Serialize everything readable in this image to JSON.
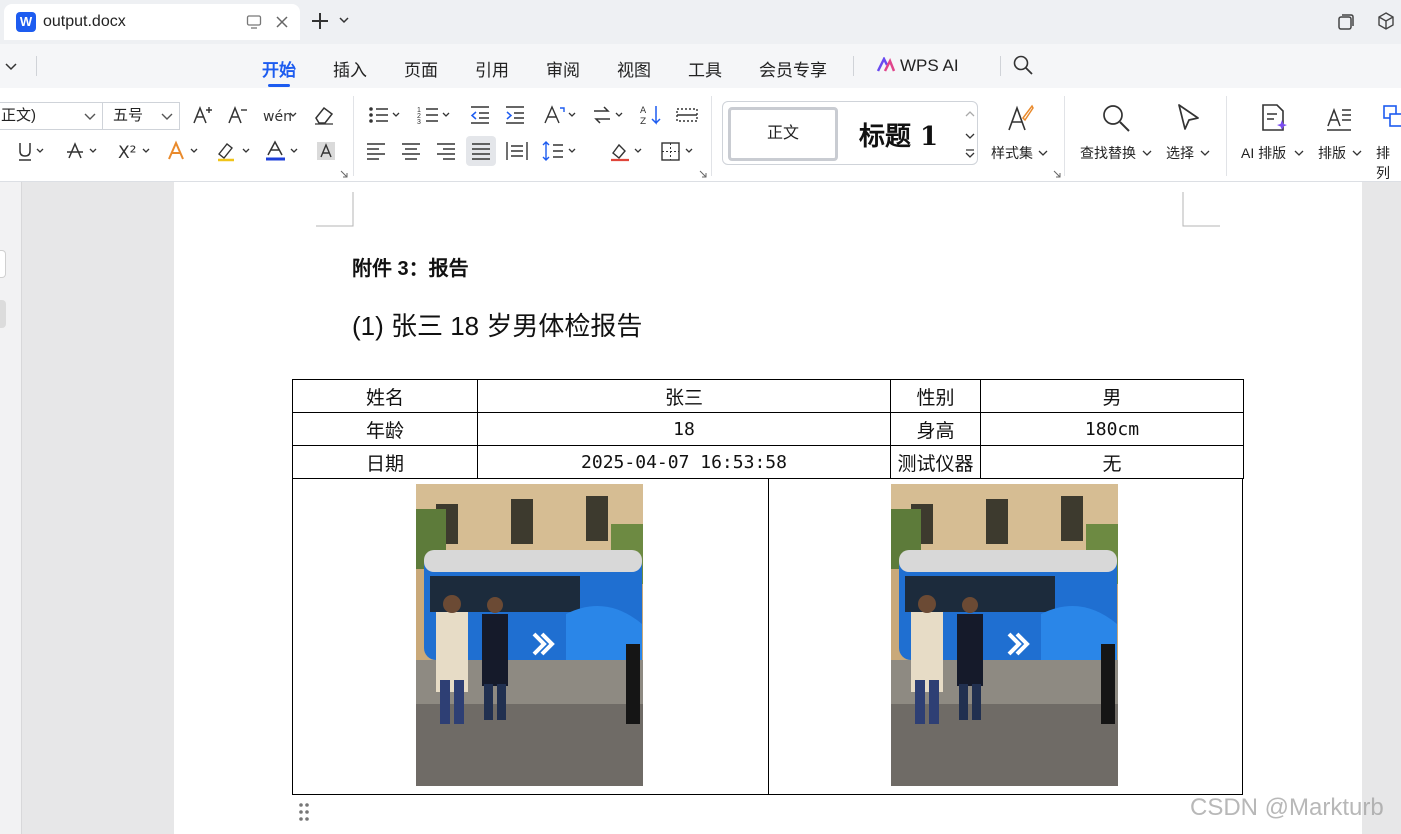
{
  "titlebar": {
    "doc_tab_title": "output.docx",
    "app_logo_letter": "W"
  },
  "menu": {
    "items": [
      "开始",
      "插入",
      "页面",
      "引用",
      "审阅",
      "视图",
      "工具",
      "会员专享"
    ],
    "active_index": 0,
    "wps_ai_label": "WPS AI"
  },
  "ribbon": {
    "font_name": "正文)",
    "font_size": "五号",
    "style_normal_label": "正文",
    "style_heading_label": "标题 1",
    "style_set_label": "样式集",
    "find_replace_label": "查找替换",
    "select_label": "选择",
    "ai_layout_label": "AI 排版",
    "layout_label": "排版",
    "arrange_label": "排列",
    "font_color": "#1d3fd9",
    "accent_color": "#1d5cf0"
  },
  "document": {
    "attachment_heading": "附件 3：报告",
    "report_heading": "(1)  张三 18 岁男体检报告",
    "table": {
      "rows": [
        [
          "姓名",
          "张三",
          "性别",
          "男"
        ],
        [
          "年龄",
          "18",
          "身高",
          "180cm"
        ],
        [
          "日期",
          "2025-04-07 16:53:58",
          "测试仪器",
          "无"
        ]
      ]
    },
    "photos": [
      {
        "description": "street photo with blue bus"
      },
      {
        "description": "street photo with blue bus"
      }
    ]
  },
  "watermark": "CSDN @Markturb"
}
